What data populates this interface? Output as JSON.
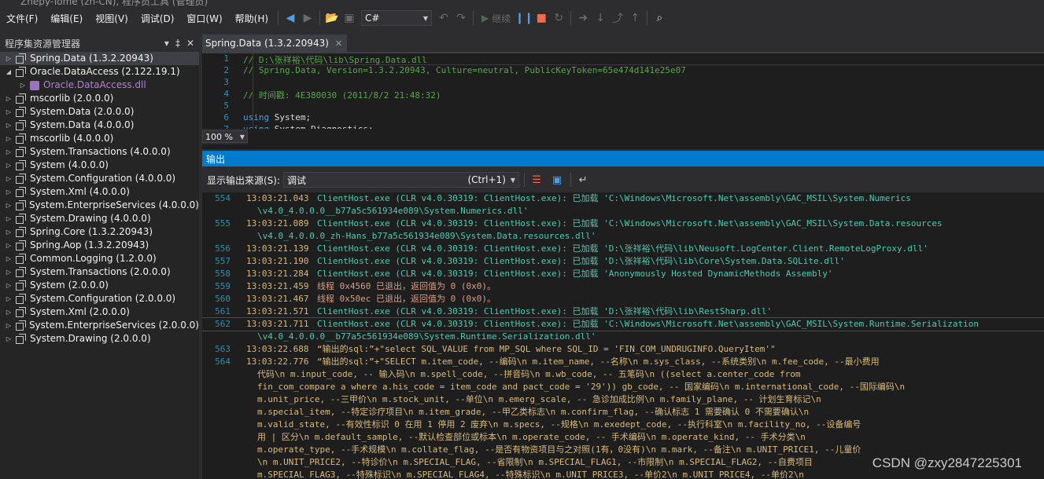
{
  "window": {
    "title_fragment": "Zhepy-Tome (zh-CN), 程序员工具 (管理员)"
  },
  "menu": [
    "文件(F)",
    "编辑(E)",
    "视图(V)",
    "调试(D)",
    "窗口(W)",
    "帮助(H)"
  ],
  "toolbar": {
    "language": "C#",
    "continue_label": "继续"
  },
  "object_browser": {
    "title": "程序集资源管理器",
    "items": [
      {
        "label": "Spring.Data (1.3.2.20943)",
        "expanded": false,
        "selected": true,
        "child": false
      },
      {
        "label": "Oracle.DataAccess (2.122.19.1)",
        "expanded": true,
        "selected": false,
        "child": false
      },
      {
        "label": "Oracle.DataAccess.dll",
        "expanded": false,
        "selected": false,
        "child": true
      },
      {
        "label": "mscorlib (2.0.0.0)",
        "expanded": false,
        "selected": false,
        "child": false
      },
      {
        "label": "System.Data (2.0.0.0)",
        "expanded": false,
        "selected": false,
        "child": false
      },
      {
        "label": "System.Data (4.0.0.0)",
        "expanded": false,
        "selected": false,
        "child": false
      },
      {
        "label": "mscorlib (4.0.0.0)",
        "expanded": false,
        "selected": false,
        "child": false
      },
      {
        "label": "System.Transactions (4.0.0.0)",
        "expanded": false,
        "selected": false,
        "child": false
      },
      {
        "label": "System (4.0.0.0)",
        "expanded": false,
        "selected": false,
        "child": false
      },
      {
        "label": "System.Configuration (4.0.0.0)",
        "expanded": false,
        "selected": false,
        "child": false
      },
      {
        "label": "System.Xml (4.0.0.0)",
        "expanded": false,
        "selected": false,
        "child": false
      },
      {
        "label": "System.EnterpriseServices (4.0.0.0)",
        "expanded": false,
        "selected": false,
        "child": false
      },
      {
        "label": "System.Drawing (4.0.0.0)",
        "expanded": false,
        "selected": false,
        "child": false
      },
      {
        "label": "Spring.Core (1.3.2.20943)",
        "expanded": false,
        "selected": false,
        "child": false
      },
      {
        "label": "Spring.Aop (1.3.2.20943)",
        "expanded": false,
        "selected": false,
        "child": false
      },
      {
        "label": "Common.Logging (1.2.0.0)",
        "expanded": false,
        "selected": false,
        "child": false
      },
      {
        "label": "System.Transactions (2.0.0.0)",
        "expanded": false,
        "selected": false,
        "child": false
      },
      {
        "label": "System (2.0.0.0)",
        "expanded": false,
        "selected": false,
        "child": false
      },
      {
        "label": "System.Configuration (2.0.0.0)",
        "expanded": false,
        "selected": false,
        "child": false
      },
      {
        "label": "System.Xml (2.0.0.0)",
        "expanded": false,
        "selected": false,
        "child": false
      },
      {
        "label": "System.EnterpriseServices (2.0.0.0)",
        "expanded": false,
        "selected": false,
        "child": false
      },
      {
        "label": "System.Drawing (2.0.0.0)",
        "expanded": false,
        "selected": false,
        "child": false
      }
    ]
  },
  "document": {
    "tab_label": "Spring.Data (1.3.2.20943)",
    "zoom": "100 %",
    "lines": [
      {
        "n": "1",
        "text": "// D:\\张祥裕\\代码\\lib\\Spring.Data.dll",
        "kind": "comment"
      },
      {
        "n": "2",
        "text": "// Spring.Data, Version=1.3.2.20943, Culture=neutral, PublicKeyToken=65e474d141e25e07",
        "kind": "comment"
      },
      {
        "n": "3",
        "text": "",
        "kind": "comment"
      },
      {
        "n": "4",
        "text": "// 时间戳: 4E380030 (2011/8/2 21:48:32)",
        "kind": "comment"
      },
      {
        "n": "5",
        "text": "",
        "kind": "comment"
      },
      {
        "n": "6",
        "text": "using System;",
        "kind": "using"
      },
      {
        "n": "7",
        "text": "using System.Diagnostics;",
        "kind": "using"
      }
    ]
  },
  "output": {
    "title": "输出",
    "source_label": "显示输出来源(S):",
    "source_value": "调试",
    "source_shortcut": "(Ctrl+1)",
    "lines": [
      {
        "num": "554",
        "ts": "13:03:21.043",
        "msg": "ClientHost.exe (CLR v4.0.30319: ClientHost.exe): 已加载 'C:\\Windows\\Microsoft.Net\\assembly\\GAC_MSIL\\System.Numerics",
        "kind": "load"
      },
      {
        "num": "",
        "ts": "",
        "msg": "\\v4.0_4.0.0.0__b77a5c561934e089\\System.Numerics.dll'",
        "kind": "load"
      },
      {
        "num": "555",
        "ts": "13:03:21.089",
        "msg": "ClientHost.exe (CLR v4.0.30319: ClientHost.exe): 已加载 'C:\\Windows\\Microsoft.Net\\assembly\\GAC_MSIL\\System.Data.resources",
        "kind": "load"
      },
      {
        "num": "",
        "ts": "",
        "msg": "\\v4.0_4.0.0.0_zh-Hans_b77a5c561934e089\\System.Data.resources.dll'",
        "kind": "load"
      },
      {
        "num": "556",
        "ts": "13:03:21.139",
        "msg": "ClientHost.exe (CLR v4.0.30319: ClientHost.exe): 已加载 'D:\\张祥裕\\代码\\lib\\Neusoft.LogCenter.Client.RemoteLogProxy.dll'",
        "kind": "load"
      },
      {
        "num": "557",
        "ts": "13:03:21.190",
        "msg": "ClientHost.exe (CLR v4.0.30319: ClientHost.exe): 已加载 'D:\\张祥裕\\代码\\lib\\Core\\System.Data.SQLite.dll'",
        "kind": "load"
      },
      {
        "num": "558",
        "ts": "13:03:21.284",
        "msg": "ClientHost.exe (CLR v4.0.30319: ClientHost.exe): 已加载 'Anonymously Hosted DynamicMethods Assembly'",
        "kind": "load"
      },
      {
        "num": "559",
        "ts": "13:03:21.459",
        "msg": "线程 0x4560 已退出，返回值为 0 (0x0)。",
        "kind": "thread"
      },
      {
        "num": "560",
        "ts": "13:03:21.467",
        "msg": "线程 0x50ec 已退出，返回值为 0 (0x0)。",
        "kind": "thread"
      },
      {
        "num": "561",
        "ts": "13:03:21.571",
        "msg": "ClientHost.exe (CLR v4.0.30319: ClientHost.exe): 已加载 'D:\\张祥裕\\代码\\lib\\RestSharp.dll'",
        "kind": "load"
      },
      {
        "num": "562",
        "ts": "13:03:21.711",
        "msg": "ClientHost.exe (CLR v4.0.30319: ClientHost.exe): 已加载 'C:\\Windows\\Microsoft.Net\\assembly\\GAC_MSIL\\System.Runtime.Serialization",
        "kind": "load",
        "current": true
      },
      {
        "num": "",
        "ts": "",
        "msg": "\\v4.0_4.0.0.0__b77a5c561934e089\\System.Runtime.Serialization.dll'",
        "kind": "load"
      },
      {
        "num": "563",
        "ts": "13:03:22.688",
        "msg": "“输出的sql:”+\"select SQL_VALUE from MP_SQL where SQL_ID = 'FIN_COM_UNDRUGINFO.QueryItem'\"",
        "kind": "sql"
      },
      {
        "num": "564",
        "ts": "13:03:22.776",
        "msg": "“输出的sql:”+\"SELECT m.item_code, --编码\\n       m.item_name, --名称\\n       m.sys_class, --系统类别\\n       m.fee_code, --最小费用",
        "kind": "sql"
      },
      {
        "num": "",
        "ts": "",
        "msg": "代码\\n       m.input_code, -- 输入码\\n       m.spell_code, --拼音码\\n       m.wb_code, -- 五笔码\\n       ((select a.center_code from",
        "kind": "sql"
      },
      {
        "num": "",
        "ts": "",
        "msg": "fin_com_compare a where a.his_code = item_code and pact_code = '29')) gb_code, -- 国家编码\\n       m.international_code, --国际编码\\n",
        "kind": "sql"
      },
      {
        "num": "",
        "ts": "",
        "msg": "m.unit_price, --三甲价\\n       m.stock_unit, --单位\\n       m.emerg_scale, -- 急诊加成比例\\n       m.family_plane, -- 计划生育标记\\n",
        "kind": "sql"
      },
      {
        "num": "",
        "ts": "",
        "msg": "m.special_item, --特定诊疗项目\\n       m.item_grade, --甲乙类标志\\n       m.confirm_flag, --确认标志 1 需要确认 0 不需要确认\\n",
        "kind": "sql"
      },
      {
        "num": "",
        "ts": "",
        "msg": "m.valid_state, --有效性标识 0 在用 1 停用 2 废弃\\n       m.specs, --规格\\n       m.exedept_code, --执行科室\\n       m.facility_no, --设备编号",
        "kind": "sql"
      },
      {
        "num": "",
        "ts": "",
        "msg": "用 | 区分\\n       m.default_sample, --默认检查部位或标本\\n       m.operate_code, -- 手术编码\\n       m.operate_kind, -- 手术分类\\n",
        "kind": "sql"
      },
      {
        "num": "",
        "ts": "",
        "msg": "m.operate_type, --手术规模\\n       m.collate_flag, --是否有物资项目与之对照(1有，0没有)\\n       m.mark, --备注\\n       m.UNIT_PRICE1, --儿童价",
        "kind": "sql"
      },
      {
        "num": "",
        "ts": "",
        "msg": "\\n       m.UNIT_PRICE2, --特诊价\\n       m.SPECIAL_FLAG, --省限制\\n       m.SPECIAL_FLAG1, --市限制\\n       m.SPECIAL_FLAG2, --自费项目",
        "kind": "sql"
      },
      {
        "num": "",
        "ts": "",
        "msg": "m.SPECIAL_FLAG3, --特殊标识\\n       m.SPECIAL_FLAG4, --特殊标识\\n       m.UNIT_PRICE3, --单价2\\n       m.UNIT_PRICE4, --单价2\\n",
        "kind": "sql"
      }
    ]
  },
  "watermark": "CSDN @zxy2847225301",
  "colors": {
    "accent": "#007acc",
    "background": "#2d2d30",
    "editor_background": "#1e1e1e",
    "line_number": "#2b91af",
    "comment": "#57a64a",
    "keyword": "#569cd6"
  }
}
